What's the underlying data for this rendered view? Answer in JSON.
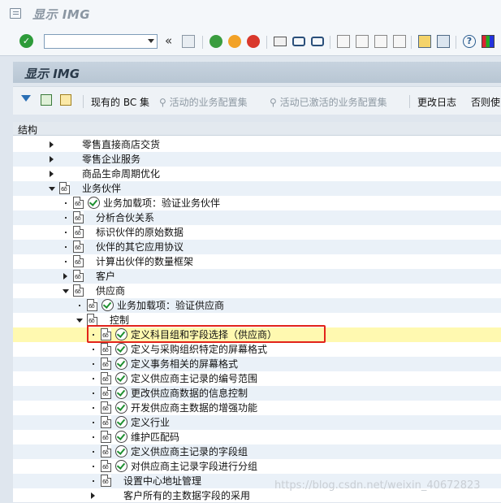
{
  "window": {
    "title": "显示 IMG"
  },
  "toolbar": {
    "command_value": ""
  },
  "app": {
    "title": "显示 IMG",
    "buttons": [
      {
        "label": "现有的 BC 集",
        "enabled": true
      },
      {
        "label": "活动的业务配置集",
        "enabled": false
      },
      {
        "label": "活动已激活的业务配置集",
        "enabled": false
      },
      {
        "label": "更改日志",
        "enabled": true
      },
      {
        "label": "否则使",
        "enabled": true
      }
    ]
  },
  "tree": {
    "header": "结构",
    "rows": [
      {
        "label": "零售直接商店交货",
        "level": 0,
        "node": "collapsed",
        "doc": false,
        "exec": false
      },
      {
        "label": "零售企业服务",
        "level": 0,
        "node": "collapsed",
        "doc": false,
        "exec": false
      },
      {
        "label": "商品生命周期优化",
        "level": 0,
        "node": "collapsed",
        "doc": false,
        "exec": false
      },
      {
        "label": "业务伙伴",
        "level": 0,
        "node": "expanded",
        "doc": true,
        "exec": false
      },
      {
        "label": "业务加载项：验证业务伙伴",
        "level": 1,
        "node": "leaf",
        "doc": true,
        "exec": true
      },
      {
        "label": "分析合伙关系",
        "level": 1,
        "node": "leaf",
        "doc": true,
        "exec": false
      },
      {
        "label": "标识伙伴的原始数据",
        "level": 1,
        "node": "leaf",
        "doc": true,
        "exec": false
      },
      {
        "label": "伙伴的其它应用协议",
        "level": 1,
        "node": "leaf",
        "doc": true,
        "exec": false
      },
      {
        "label": "计算出伙伴的数量框架",
        "level": 1,
        "node": "leaf",
        "doc": true,
        "exec": false
      },
      {
        "label": "客户",
        "level": 1,
        "node": "collapsed",
        "doc": true,
        "exec": false
      },
      {
        "label": "供应商",
        "level": 1,
        "node": "expanded",
        "doc": true,
        "exec": false
      },
      {
        "label": "业务加载项：验证供应商",
        "level": 2,
        "node": "leaf",
        "doc": true,
        "exec": true
      },
      {
        "label": "控制",
        "level": 2,
        "node": "expanded",
        "doc": true,
        "exec": false
      },
      {
        "label": "定义科目组和字段选择（供应商）",
        "level": 3,
        "node": "leaf",
        "doc": true,
        "exec": true,
        "highlighted": true
      },
      {
        "label": "定义与采购组织特定的屏幕格式",
        "level": 3,
        "node": "leaf",
        "doc": true,
        "exec": true
      },
      {
        "label": "定义事务相关的屏幕格式",
        "level": 3,
        "node": "leaf",
        "doc": true,
        "exec": true
      },
      {
        "label": "定义供应商主记录的编号范围",
        "level": 3,
        "node": "leaf",
        "doc": true,
        "exec": true
      },
      {
        "label": "更改供应商数据的信息控制",
        "level": 3,
        "node": "leaf",
        "doc": true,
        "exec": true
      },
      {
        "label": "开发供应商主数据的增强功能",
        "level": 3,
        "node": "leaf",
        "doc": true,
        "exec": true
      },
      {
        "label": "定义行业",
        "level": 3,
        "node": "leaf",
        "doc": true,
        "exec": true
      },
      {
        "label": "维护匹配码",
        "level": 3,
        "node": "leaf",
        "doc": true,
        "exec": true
      },
      {
        "label": "定义供应商主记录的字段组",
        "level": 3,
        "node": "leaf",
        "doc": true,
        "exec": true
      },
      {
        "label": "对供应商主记录字段进行分组",
        "level": 3,
        "node": "leaf",
        "doc": true,
        "exec": true
      },
      {
        "label": "设置中心地址管理",
        "level": 3,
        "node": "leaf",
        "doc": true,
        "exec": false
      },
      {
        "label": "客户所有的主数据字段的采用",
        "level": 3,
        "node": "collapsed",
        "doc": false,
        "exec": false
      }
    ]
  },
  "watermark": "https://blog.csdn.net/weixin_40672823"
}
